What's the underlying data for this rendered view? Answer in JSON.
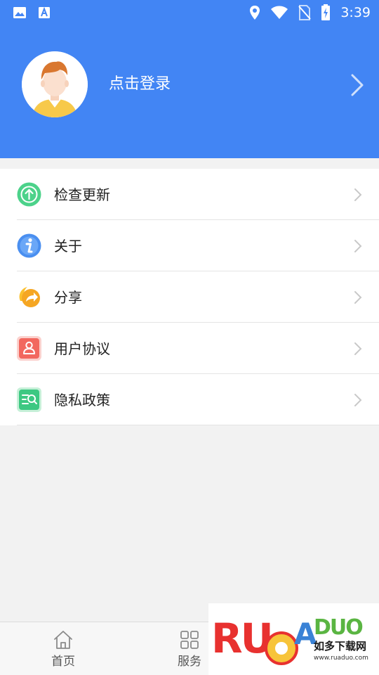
{
  "status_bar": {
    "time": "3:39",
    "left_icons": [
      "image-icon",
      "text-a-icon"
    ],
    "right_icons": [
      "location-icon",
      "wifi-icon",
      "no-sim-icon",
      "battery-charging-icon"
    ]
  },
  "profile": {
    "login_label": "点击登录",
    "avatar": "user-avatar"
  },
  "menu": {
    "items": [
      {
        "label": "检查更新",
        "icon": "update-icon",
        "color": "#4cd28a"
      },
      {
        "label": "关于",
        "icon": "info-icon",
        "color": "#4a8ff0"
      },
      {
        "label": "分享",
        "icon": "share-icon",
        "color": "#f5a623"
      },
      {
        "label": "用户协议",
        "icon": "user-agreement-icon",
        "color": "#f2685f"
      },
      {
        "label": "隐私政策",
        "icon": "privacy-policy-icon",
        "color": "#3dc882"
      }
    ]
  },
  "bottom_nav": {
    "items": [
      {
        "label": "首页",
        "icon": "home-icon"
      },
      {
        "label": "服务",
        "icon": "grid-icon"
      }
    ]
  },
  "watermark": {
    "text": "RUOADUO",
    "subtitle": "如多下载网",
    "url": "www.ruaduo.com"
  },
  "colors": {
    "header": "#4285f4",
    "background": "#f2f2f2"
  }
}
